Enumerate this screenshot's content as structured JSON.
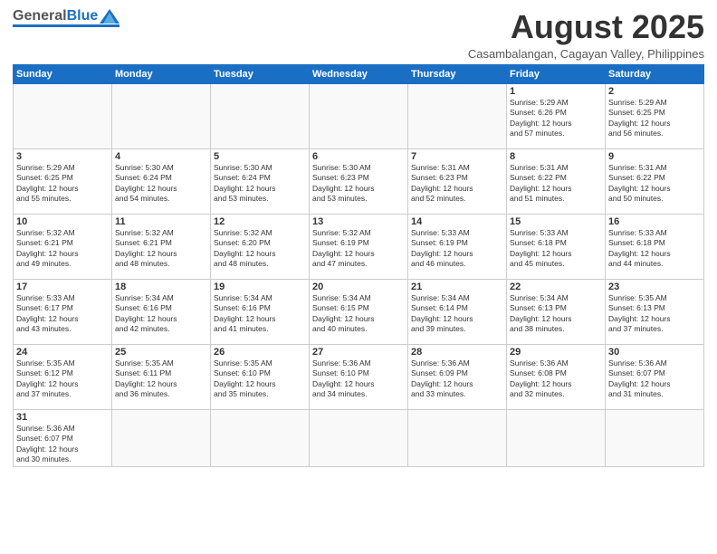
{
  "logo": {
    "general": "General",
    "blue": "Blue"
  },
  "title": "August 2025",
  "subtitle": "Casambalangan, Cagayan Valley, Philippines",
  "days_header": [
    "Sunday",
    "Monday",
    "Tuesday",
    "Wednesday",
    "Thursday",
    "Friday",
    "Saturday"
  ],
  "weeks": [
    [
      {
        "day": "",
        "info": ""
      },
      {
        "day": "",
        "info": ""
      },
      {
        "day": "",
        "info": ""
      },
      {
        "day": "",
        "info": ""
      },
      {
        "day": "",
        "info": ""
      },
      {
        "day": "1",
        "info": "Sunrise: 5:29 AM\nSunset: 6:26 PM\nDaylight: 12 hours\nand 57 minutes."
      },
      {
        "day": "2",
        "info": "Sunrise: 5:29 AM\nSunset: 6:25 PM\nDaylight: 12 hours\nand 56 minutes."
      }
    ],
    [
      {
        "day": "3",
        "info": "Sunrise: 5:29 AM\nSunset: 6:25 PM\nDaylight: 12 hours\nand 55 minutes."
      },
      {
        "day": "4",
        "info": "Sunrise: 5:30 AM\nSunset: 6:24 PM\nDaylight: 12 hours\nand 54 minutes."
      },
      {
        "day": "5",
        "info": "Sunrise: 5:30 AM\nSunset: 6:24 PM\nDaylight: 12 hours\nand 53 minutes."
      },
      {
        "day": "6",
        "info": "Sunrise: 5:30 AM\nSunset: 6:23 PM\nDaylight: 12 hours\nand 53 minutes."
      },
      {
        "day": "7",
        "info": "Sunrise: 5:31 AM\nSunset: 6:23 PM\nDaylight: 12 hours\nand 52 minutes."
      },
      {
        "day": "8",
        "info": "Sunrise: 5:31 AM\nSunset: 6:22 PM\nDaylight: 12 hours\nand 51 minutes."
      },
      {
        "day": "9",
        "info": "Sunrise: 5:31 AM\nSunset: 6:22 PM\nDaylight: 12 hours\nand 50 minutes."
      }
    ],
    [
      {
        "day": "10",
        "info": "Sunrise: 5:32 AM\nSunset: 6:21 PM\nDaylight: 12 hours\nand 49 minutes."
      },
      {
        "day": "11",
        "info": "Sunrise: 5:32 AM\nSunset: 6:21 PM\nDaylight: 12 hours\nand 48 minutes."
      },
      {
        "day": "12",
        "info": "Sunrise: 5:32 AM\nSunset: 6:20 PM\nDaylight: 12 hours\nand 48 minutes."
      },
      {
        "day": "13",
        "info": "Sunrise: 5:32 AM\nSunset: 6:19 PM\nDaylight: 12 hours\nand 47 minutes."
      },
      {
        "day": "14",
        "info": "Sunrise: 5:33 AM\nSunset: 6:19 PM\nDaylight: 12 hours\nand 46 minutes."
      },
      {
        "day": "15",
        "info": "Sunrise: 5:33 AM\nSunset: 6:18 PM\nDaylight: 12 hours\nand 45 minutes."
      },
      {
        "day": "16",
        "info": "Sunrise: 5:33 AM\nSunset: 6:18 PM\nDaylight: 12 hours\nand 44 minutes."
      }
    ],
    [
      {
        "day": "17",
        "info": "Sunrise: 5:33 AM\nSunset: 6:17 PM\nDaylight: 12 hours\nand 43 minutes."
      },
      {
        "day": "18",
        "info": "Sunrise: 5:34 AM\nSunset: 6:16 PM\nDaylight: 12 hours\nand 42 minutes."
      },
      {
        "day": "19",
        "info": "Sunrise: 5:34 AM\nSunset: 6:16 PM\nDaylight: 12 hours\nand 41 minutes."
      },
      {
        "day": "20",
        "info": "Sunrise: 5:34 AM\nSunset: 6:15 PM\nDaylight: 12 hours\nand 40 minutes."
      },
      {
        "day": "21",
        "info": "Sunrise: 5:34 AM\nSunset: 6:14 PM\nDaylight: 12 hours\nand 39 minutes."
      },
      {
        "day": "22",
        "info": "Sunrise: 5:34 AM\nSunset: 6:13 PM\nDaylight: 12 hours\nand 38 minutes."
      },
      {
        "day": "23",
        "info": "Sunrise: 5:35 AM\nSunset: 6:13 PM\nDaylight: 12 hours\nand 37 minutes."
      }
    ],
    [
      {
        "day": "24",
        "info": "Sunrise: 5:35 AM\nSunset: 6:12 PM\nDaylight: 12 hours\nand 37 minutes."
      },
      {
        "day": "25",
        "info": "Sunrise: 5:35 AM\nSunset: 6:11 PM\nDaylight: 12 hours\nand 36 minutes."
      },
      {
        "day": "26",
        "info": "Sunrise: 5:35 AM\nSunset: 6:10 PM\nDaylight: 12 hours\nand 35 minutes."
      },
      {
        "day": "27",
        "info": "Sunrise: 5:36 AM\nSunset: 6:10 PM\nDaylight: 12 hours\nand 34 minutes."
      },
      {
        "day": "28",
        "info": "Sunrise: 5:36 AM\nSunset: 6:09 PM\nDaylight: 12 hours\nand 33 minutes."
      },
      {
        "day": "29",
        "info": "Sunrise: 5:36 AM\nSunset: 6:08 PM\nDaylight: 12 hours\nand 32 minutes."
      },
      {
        "day": "30",
        "info": "Sunrise: 5:36 AM\nSunset: 6:07 PM\nDaylight: 12 hours\nand 31 minutes."
      }
    ],
    [
      {
        "day": "31",
        "info": "Sunrise: 5:36 AM\nSunset: 6:07 PM\nDaylight: 12 hours\nand 30 minutes."
      },
      {
        "day": "",
        "info": ""
      },
      {
        "day": "",
        "info": ""
      },
      {
        "day": "",
        "info": ""
      },
      {
        "day": "",
        "info": ""
      },
      {
        "day": "",
        "info": ""
      },
      {
        "day": "",
        "info": ""
      }
    ]
  ]
}
